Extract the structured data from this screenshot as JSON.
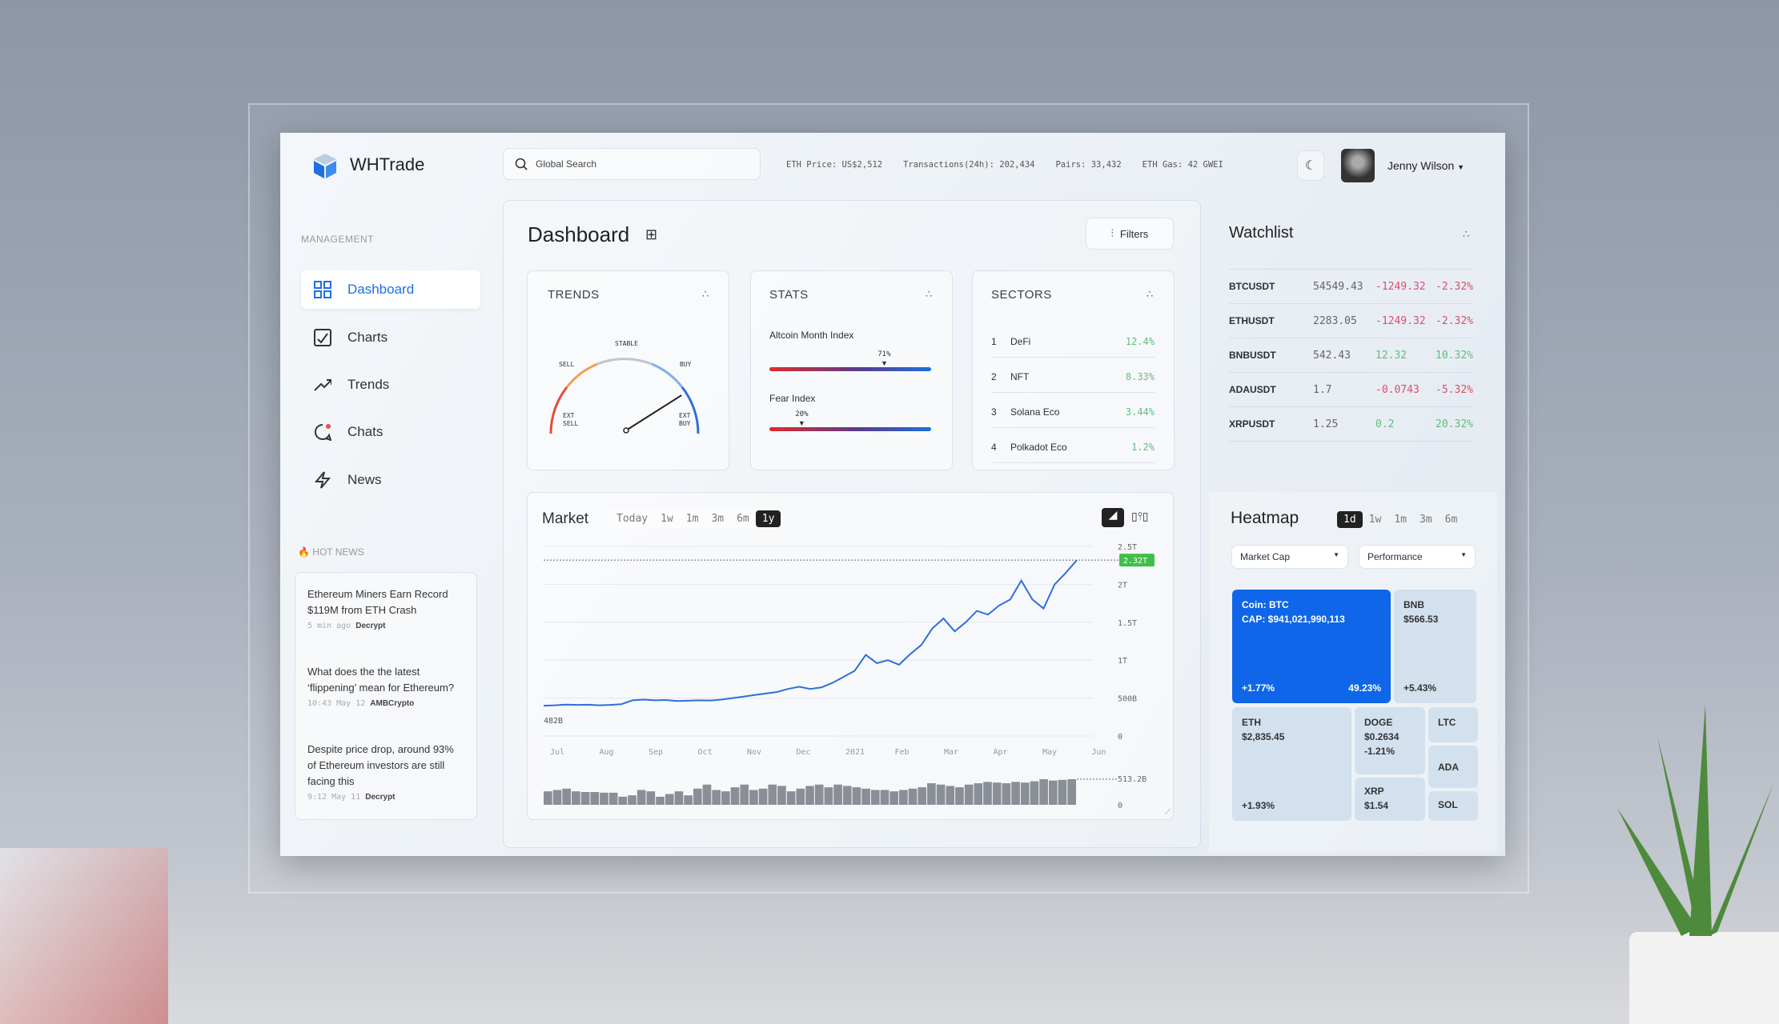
{
  "app": {
    "name": "WHTrade"
  },
  "header": {
    "search_placeholder": "Global Search",
    "eth_price": "ETH Price: US$2,512",
    "transactions": "Transactions(24h): 202,434",
    "pairs": "Pairs: 33,432",
    "eth_gas": "ETH Gas: 42 GWEI",
    "user": "Jenny Wilson"
  },
  "sidebar": {
    "section": "MANAGEMENT",
    "items": [
      {
        "label": "Dashboard",
        "icon": "grid-icon",
        "active": true
      },
      {
        "label": "Charts",
        "icon": "chart-check-icon"
      },
      {
        "label": "Trends",
        "icon": "trend-up-icon"
      },
      {
        "label": "Chats",
        "icon": "chat-icon"
      },
      {
        "label": "News",
        "icon": "lightning-icon"
      }
    ],
    "hot_news_label": "HOT NEWS",
    "news": [
      {
        "title": "Ethereum Miners Earn Record $119M from ETH Crash",
        "time": "5 min ago",
        "source": "Decrypt"
      },
      {
        "title": "What does the the latest ‘flippening’ mean for Ethereum?",
        "time": "10:43 May 12",
        "source": "AMBCrypto"
      },
      {
        "title": "Despite price drop, around 93% of Ethereum investors are still facing this",
        "time": "9:12 May 11",
        "source": "Decrypt"
      }
    ]
  },
  "dashboard": {
    "title": "Dashboard",
    "filters": "Filters",
    "trends": {
      "title": "TRENDS",
      "labels": {
        "stable": "STABLE",
        "sell": "SELL",
        "buy": "BUY",
        "ext_sell": "EXT SELL",
        "ext_buy": "EXT BUY"
      },
      "needle_level": 0.82
    },
    "stats": {
      "title": "STATS",
      "items": [
        {
          "label": "Altcoin Month Index",
          "value": 71,
          "display": "71%"
        },
        {
          "label": "Fear Index",
          "value": 20,
          "display": "20%"
        }
      ]
    },
    "sectors": {
      "title": "SECTORS",
      "rows": [
        {
          "rank": "1",
          "name": "DeFi",
          "value": "12.4%"
        },
        {
          "rank": "2",
          "name": "NFT",
          "value": "8.33%"
        },
        {
          "rank": "3",
          "name": "Solana Eco",
          "value": "3.44%"
        },
        {
          "rank": "4",
          "name": "Polkadot Eco",
          "value": "1.2%"
        }
      ]
    },
    "market": {
      "title": "Market",
      "tabs": [
        "Today",
        "1w",
        "1m",
        "3m",
        "6m",
        "1y"
      ],
      "active_tab": "1y"
    }
  },
  "chart_data": {
    "type": "line",
    "accent": "#2f6fd6",
    "x_ticks": [
      "Jul",
      "Aug",
      "Sep",
      "Oct",
      "Nov",
      "Dec",
      "2021",
      "Feb",
      "Mar",
      "Apr",
      "May",
      "Jun"
    ],
    "y_ticks": [
      "2.5T",
      "2T",
      "1.5T",
      "1T",
      "500B",
      "0"
    ],
    "ylim": [
      0,
      2500
    ],
    "unit": "B",
    "start_label": "482B",
    "current_label": "2.32T",
    "values": [
      400,
      405,
      415,
      410,
      412,
      405,
      410,
      420,
      470,
      480,
      470,
      475,
      462,
      465,
      470,
      468,
      480,
      500,
      520,
      540,
      560,
      580,
      620,
      650,
      620,
      640,
      700,
      780,
      860,
      1070,
      960,
      1000,
      940,
      1080,
      1200,
      1420,
      1550,
      1380,
      1500,
      1650,
      1600,
      1720,
      1800,
      2050,
      1800,
      1680,
      2000,
      2150,
      2320
    ],
    "volume_label": "513.2B",
    "volume_zero": "0",
    "volume": [
      20,
      22,
      24,
      20,
      19,
      19,
      18,
      18,
      12,
      14,
      22,
      20,
      12,
      16,
      20,
      14,
      24,
      30,
      22,
      20,
      26,
      30,
      22,
      24,
      30,
      28,
      20,
      24,
      28,
      30,
      26,
      30,
      28,
      26,
      24,
      22,
      22,
      20,
      22,
      24,
      26,
      32,
      30,
      28,
      26,
      30,
      32,
      34,
      33,
      32,
      34,
      33,
      35,
      38,
      36,
      37,
      38
    ]
  },
  "watchlist": {
    "title": "Watchlist",
    "rows": [
      {
        "pair": "BTCUSDT",
        "price": "54549.43",
        "change": "-1249.32",
        "pct": "-2.32%",
        "up": false
      },
      {
        "pair": "ETHUSDT",
        "price": "2283.05",
        "change": "-1249.32",
        "pct": "-2.32%",
        "up": false
      },
      {
        "pair": "BNBUSDT",
        "price": "542.43",
        "change": "12.32",
        "pct": "10.32%",
        "up": true
      },
      {
        "pair": "ADAUSDT",
        "price": "1.7",
        "change": "-0.0743",
        "pct": "-5.32%",
        "up": false
      },
      {
        "pair": "XRPUSDT",
        "price": "1.25",
        "change": "0.2",
        "pct": "20.32%",
        "up": true
      }
    ]
  },
  "heatmap": {
    "title": "Heatmap",
    "tabs": [
      "1d",
      "1w",
      "1m",
      "3m",
      "6m"
    ],
    "active_tab": "1d",
    "select1": "Market Cap",
    "select2": "Performance",
    "btc": {
      "coin": "Coin: BTC",
      "cap": "CAP: $941,021,990,113",
      "change": "+1.77%",
      "dominance": "49.23%",
      "color": "#0f66e8"
    },
    "bnb": {
      "name": "BNB",
      "price": "$566.53",
      "change": "+5.43%"
    },
    "eth": {
      "name": "ETH",
      "price": "$2,835.45",
      "change": "+1.93%"
    },
    "doge": {
      "name": "DOGE",
      "price": "$0.2634",
      "change": "-1.21%"
    },
    "xrp": {
      "name": "XRP",
      "price": "$1.54"
    },
    "ltc": {
      "name": "LTC"
    },
    "ada": {
      "name": "ADA"
    },
    "sol": {
      "name": "SOL"
    }
  }
}
